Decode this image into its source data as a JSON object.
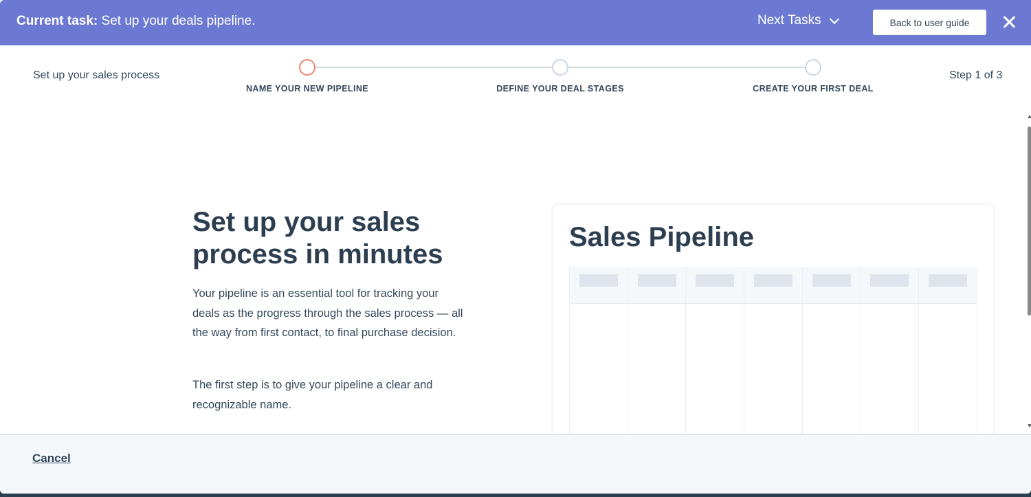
{
  "topbar": {
    "task_prefix": "Current task:",
    "task_text": "Set up your deals pipeline.",
    "next_tasks_label": "Next Tasks",
    "back_button_label": "Back to user guide",
    "accent_color": "#6b79d2"
  },
  "stepper": {
    "process_title": "Set up your sales process",
    "step_count": "Step 1 of 3",
    "current_step": 1,
    "steps": [
      {
        "label": "NAME YOUR NEW PIPELINE",
        "state": "active"
      },
      {
        "label": "DEFINE YOUR DEAL STAGES",
        "state": "upcoming"
      },
      {
        "label": "CREATE YOUR FIRST DEAL",
        "state": "upcoming"
      }
    ],
    "active_color": "#f2826e"
  },
  "content": {
    "headline": "Set up your sales process in minutes",
    "paragraph1": "Your pipeline is an essential tool for tracking your deals as the progress through the sales process — all the way from first contact, to final purchase decision.",
    "paragraph2": "The first step is to give your pipeline a clear and recognizable name."
  },
  "illustration": {
    "title": "Sales Pipeline",
    "column_count": 7
  },
  "footer": {
    "cancel_label": "Cancel"
  }
}
